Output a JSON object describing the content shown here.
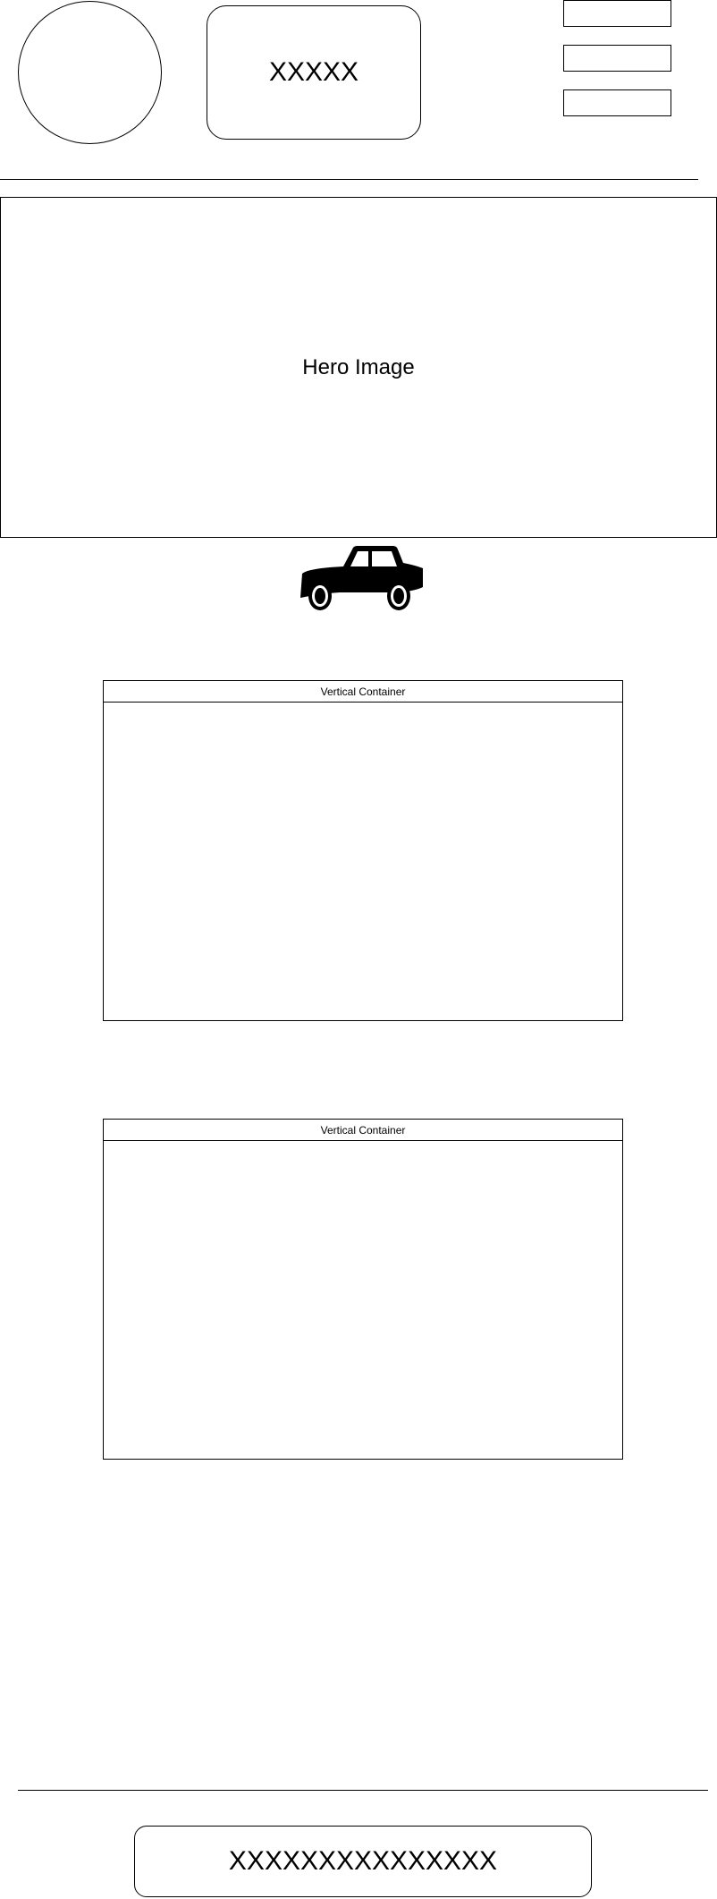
{
  "header": {
    "title_text": "XXXXX",
    "nav_items": [
      "",
      "",
      ""
    ]
  },
  "hero": {
    "label": "Hero Image"
  },
  "icon": {
    "name": "car-icon"
  },
  "containers": [
    {
      "title": "Vertical Container"
    },
    {
      "title": "Vertical Container"
    }
  ],
  "footer": {
    "text": "XXXXXXXXXXXXXXX"
  },
  "colors": {
    "stroke": "#000000",
    "background": "#ffffff"
  }
}
